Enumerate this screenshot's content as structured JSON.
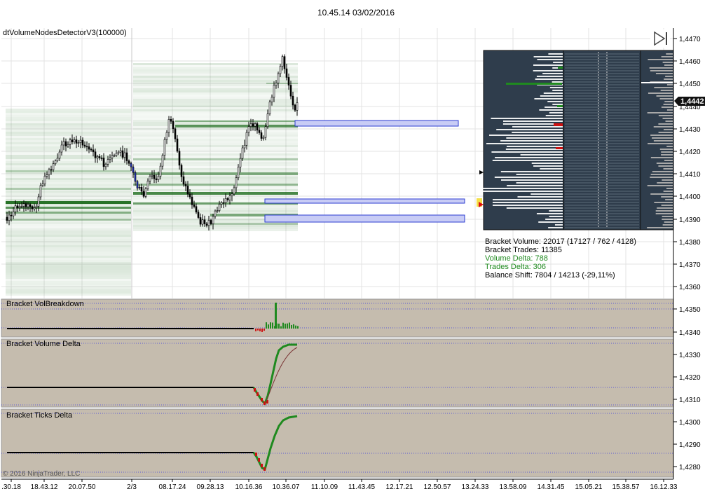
{
  "window": {
    "title": "10.45.14 03/02/2016"
  },
  "indicator": {
    "name": "dtVolumeNodesDetectorV3(100000)"
  },
  "panels": {
    "vol_breakdown": "Bracket VolBreakdown",
    "volume_delta": "Bracket Volume Delta",
    "ticks_delta": "Bracket Ticks Delta"
  },
  "copyright": "© 2016 NinjaTrader, LLC",
  "price_axis": {
    "ticks": [
      "1,4470",
      "1,4460",
      "1,4450",
      "1,4440",
      "1,4430",
      "1,4420",
      "1,4410",
      "1,4400",
      "1,4390",
      "1,4380",
      "1,4370",
      "1,4360",
      "1,4350",
      "1,4340",
      "1,4330",
      "1,4320",
      "1,4310",
      "1,4300",
      "1,4290",
      "1,4280"
    ],
    "current_price": "1,4442"
  },
  "time_axis": {
    "ticks": [
      ".30.18",
      "18.43.12",
      "20.07.50",
      "2/3",
      "08.17.24",
      "09.28.13",
      "10.16.36",
      "10.36.07",
      "11.10.09",
      "11.43.45",
      "12.17.21",
      "12.50.57",
      "13.24.33",
      "13.58.09",
      "14.31.45",
      "15.05.21",
      "15.38.57",
      "16.12.33"
    ]
  },
  "stats": {
    "bracket_volume": "Bracket Volume: 22017 (17127 / 762 / 4128)",
    "bracket_trades": "Bracket Trades: 11385",
    "volume_delta": "Volume Delta: 788",
    "trades_delta": "Trades Delta: 306",
    "balance_shift": "Balance Shift: 7804 / 14213 (-29,11%)"
  },
  "colors": {
    "candle_up": "#ffffff",
    "candle_down": "#000000",
    "volume_node": "#1d6b1d",
    "zone_fill": "#c8ccf5",
    "zone_stroke": "#2b3bd1",
    "panel_bg": "#c5bcae",
    "profile_bg": "#2f3d4c",
    "delta_up": "#1f8a1f",
    "delta_down": "#cc1111"
  },
  "icons": {
    "scroll_end": "skip-to-end-icon"
  }
}
